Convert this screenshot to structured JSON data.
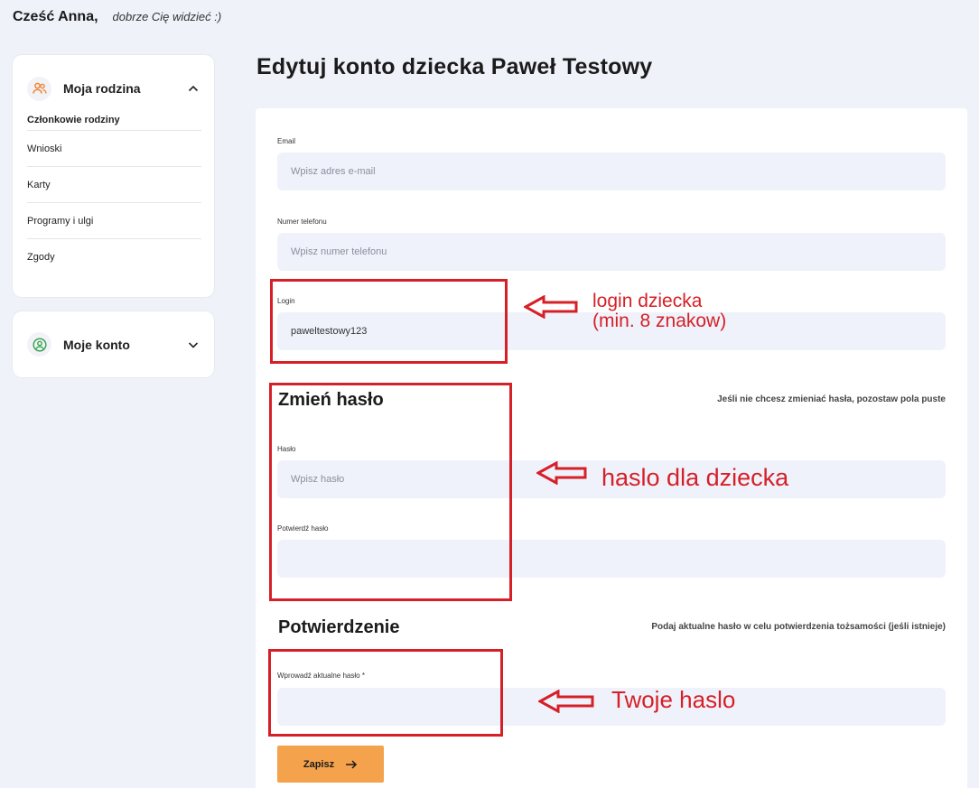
{
  "header": {
    "greeting_name": "Cześć Anna,",
    "greeting_sub": "dobrze Cię widzieć :)"
  },
  "sidebar": {
    "family": {
      "title": "Moja rodzina",
      "icon": "users-icon",
      "items": [
        {
          "label": "Członkowie rodziny",
          "active": true
        },
        {
          "label": "Wnioski"
        },
        {
          "label": "Karty"
        },
        {
          "label": "Programy i ulgi"
        },
        {
          "label": "Zgody"
        }
      ]
    },
    "account": {
      "title": "Moje konto",
      "icon": "user-circle-icon"
    }
  },
  "main": {
    "title": "Edytuj konto dziecka Paweł Testowy",
    "email": {
      "label": "Email",
      "placeholder": "Wpisz adres e-mail",
      "value": ""
    },
    "phone": {
      "label": "Numer telefonu",
      "placeholder": "Wpisz numer telefonu",
      "value": ""
    },
    "login": {
      "label": "Login",
      "value": "paweltestowy123"
    },
    "password_section": {
      "title": "Zmień hasło",
      "hint": "Jeśli nie chcesz zmieniać hasła, pozostaw pola puste",
      "password": {
        "label": "Hasło",
        "placeholder": "Wpisz hasło"
      },
      "confirm": {
        "label": "Potwierdź hasło",
        "placeholder": ""
      }
    },
    "confirmation_section": {
      "title": "Potwierdzenie",
      "hint": "Podaj aktualne hasło w celu potwierdzenia tożsamości (jeśli istnieje)",
      "current_password": {
        "label": "Wprowadź aktualne hasło *",
        "placeholder": ""
      }
    },
    "save_label": "Zapisz"
  },
  "annotations": {
    "login_line1": "login dziecka",
    "login_line2": "(min. 8 znakow)",
    "password_note": "haslo dla dziecka",
    "current_password_note": "Twoje haslo"
  },
  "colors": {
    "background": "#eff2f9",
    "input_bg": "#eff2fb",
    "accent": "#f4a24b",
    "annotation": "#d62027",
    "family_icon": "#f08a3c",
    "account_icon": "#3aa655"
  }
}
